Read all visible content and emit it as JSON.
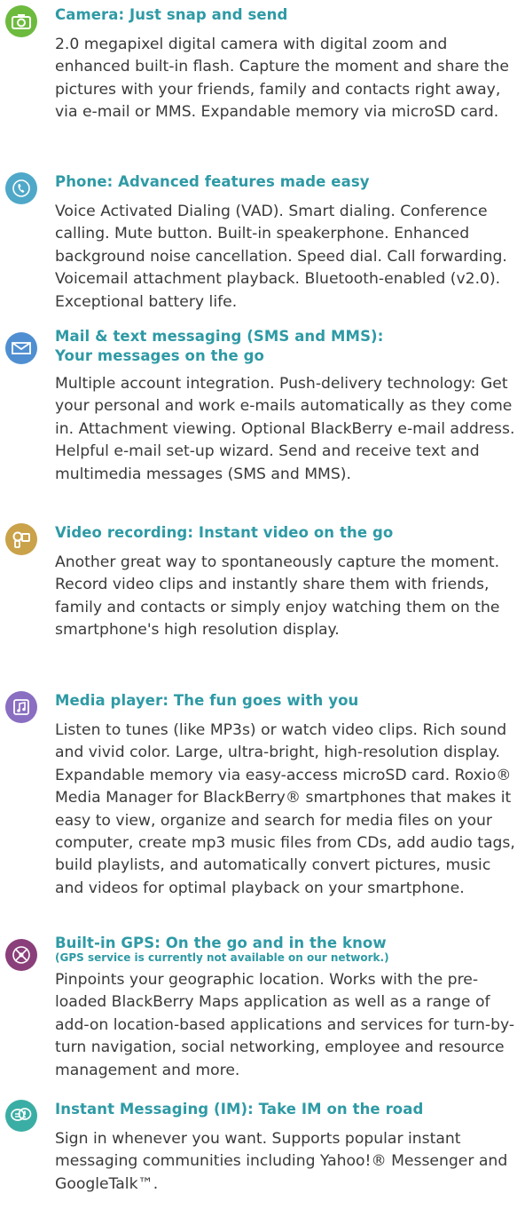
{
  "colors": {
    "heading": "#2e9aa5",
    "body_text": "#3a3a3a",
    "icon_camera": "#6dbb3e",
    "icon_phone": "#4fa8c8",
    "icon_mail": "#4f8fd1",
    "icon_video": "#c9a24a",
    "icon_media": "#8a6ec1",
    "icon_gps": "#8a3f7a",
    "icon_im": "#3aaea4"
  },
  "features": [
    {
      "icon": "camera-icon",
      "title": "Camera: Just snap and send",
      "body": "2.0 megapixel digital camera with digital zoom and enhanced built-in flash. Capture the moment and share the pictures with your friends, family and contacts right away, via e-mail or MMS. Expandable memory via microSD card."
    },
    {
      "icon": "phone-icon",
      "title": "Phone: Advanced features made easy",
      "body": "Voice Activated Dialing (VAD). Smart dialing. Conference calling. Mute button. Built-in speakerphone. Enhanced background noise cancellation. Speed dial. Call forwarding. Voicemail attachment playback. Bluetooth-enabled (v2.0). Exceptional battery life."
    },
    {
      "icon": "envelope-icon",
      "title": "Mail & text messaging (SMS and MMS):\nYour messages on the go",
      "body": "Multiple account integration. Push-delivery technology: Get your personal and work e-mails automatically as they come in. Attachment viewing. Optional BlackBerry e-mail address. Helpful e-mail set-up wizard. Send and receive text and multimedia messages (SMS and MMS)."
    },
    {
      "icon": "video-camera-icon",
      "title": "Video recording: Instant video on the go",
      "body": "Another great way to spontaneously capture the moment. Record video clips and instantly share them with friends, family and contacts or simply enjoy watching them on the smartphone's high resolution display."
    },
    {
      "icon": "music-note-icon",
      "title": "Media player: The fun goes with you",
      "body": "Listen to tunes (like MP3s) or watch video clips. Rich sound and vivid color. Large, ultra-bright, high-resolution display. Expandable memory via easy-access microSD card. Roxio® Media Manager for BlackBerry® smartphones that makes it easy to view, organize and search for media files on your computer, create mp3 music files from CDs, add audio tags, build playlists, and automatically convert pictures, music and videos for optimal playback on your smartphone."
    },
    {
      "icon": "gps-icon",
      "title": "Built-in GPS: On the go and in the know",
      "note": "(GPS service is currently not available on our network.)",
      "body": "Pinpoints your geographic location. Works with the pre-loaded BlackBerry Maps application as well as a range of add-on location-based applications and services for turn-by-turn navigation, social networking, employee and resource management and more."
    },
    {
      "icon": "chat-bubble-icon",
      "title": "Instant Messaging (IM): Take IM on the road",
      "body": "Sign in whenever you want. Supports popular instant messaging communities including Yahoo!® Messenger and GoogleTalk™."
    }
  ]
}
